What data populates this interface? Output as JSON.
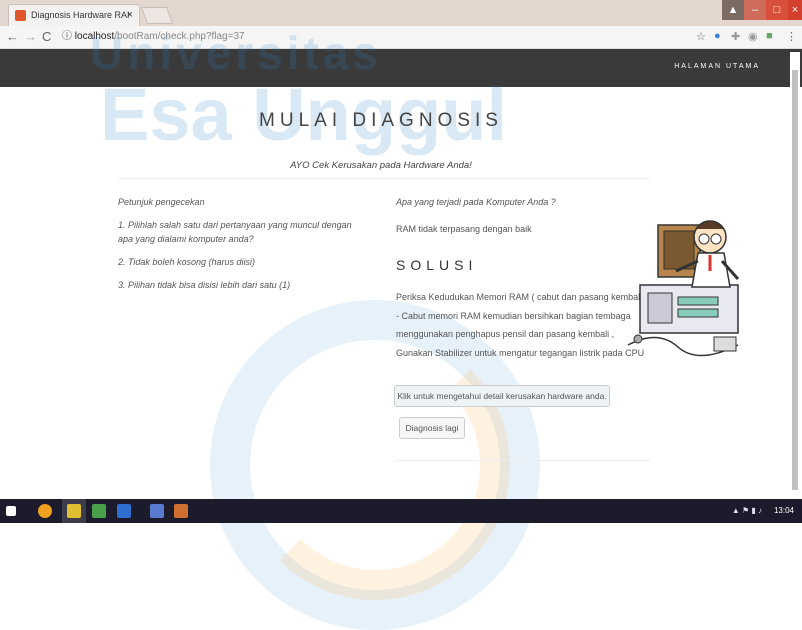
{
  "browser": {
    "tab_title": "Diagnosis Hardware RAI",
    "tab_close": "×",
    "url_host": "localhost",
    "url_path": "/bootRam/check.php?flag=37",
    "info_icon": "ⓘ"
  },
  "window_controls": {
    "minimize": "–",
    "restore": "□",
    "close": "×"
  },
  "watermark": {
    "line1": "Universitas",
    "line2": "Esa Unggul"
  },
  "nav": {
    "home": "HALAMAN UTAMA"
  },
  "page": {
    "title": "MULAI DIAGNOSIS",
    "subtitle": "AYO Cek Kerusakan pada Hardware Anda!"
  },
  "instructions": {
    "heading": "Petunjuk pengecekan",
    "items": [
      "1. Pilihlah salah satu dari pertanyaan yang muncul dengan apa yang dialami komputer anda?",
      "2. Tidak boleh kosong (harus diisi)",
      "3. Pilihan tidak bisa disisi lebih dari satu (1)"
    ]
  },
  "result": {
    "question": "Apa yang terjadi pada Komputer Anda ?",
    "answer": "RAM tidak terpasang dengan baik",
    "solution_heading": "SOLUSI",
    "solution_text": "Periksa Kedudukan Memori RAM ( cabut dan pasang kembali) - Cabut memori RAM kemudian bersihkan bagian tembaga menggunakan penghapus pensil dan pasang kembali , Gunakan Stabilizer untuk mengatur tegangan listrik pada CPU"
  },
  "buttons": {
    "detail": "Klik untuk mengetahui detail kerusakan hardware anda.",
    "again": "Diagnosis lagi"
  },
  "taskbar": {
    "time": "13:04"
  },
  "colors": {
    "nav_bg": "#3a3a3a",
    "accent": "#2f86c9"
  }
}
